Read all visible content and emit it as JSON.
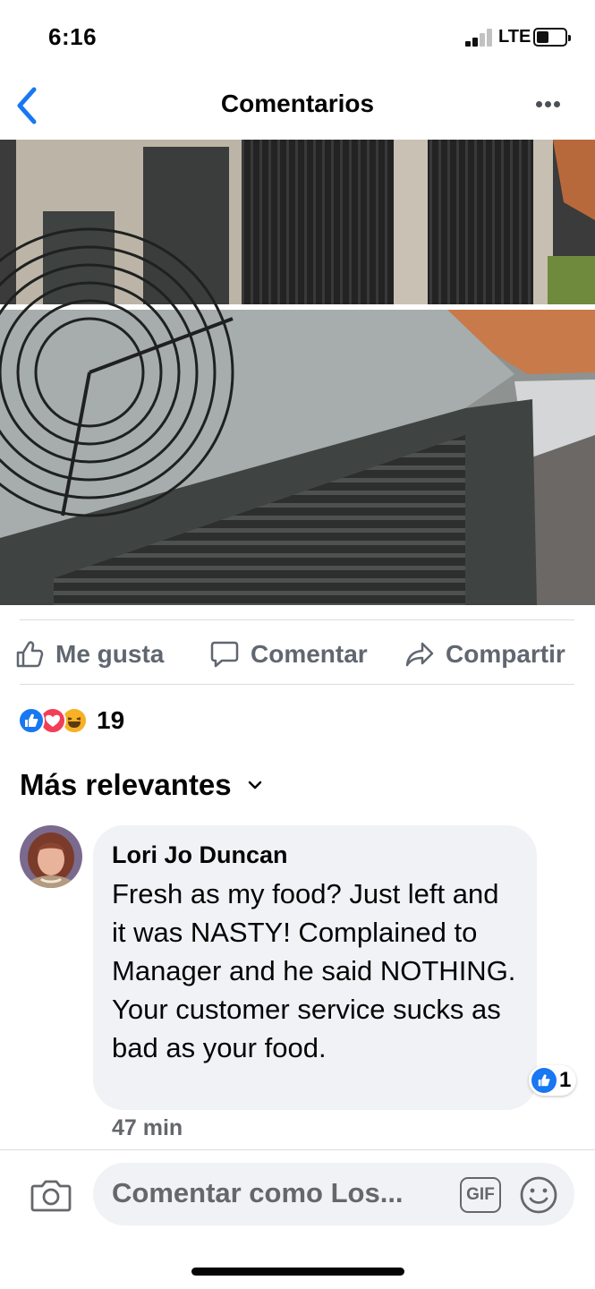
{
  "status_bar": {
    "time": "6:16",
    "network": "LTE"
  },
  "header": {
    "title": "Comentarios"
  },
  "post_actions": {
    "like": "Me gusta",
    "comment": "Comentar",
    "share": "Compartir"
  },
  "reactions": {
    "count": "19"
  },
  "sort": {
    "label": "Más relevantes"
  },
  "comment": {
    "author": "Lori Jo Duncan",
    "text": "Fresh as my food?  Just left and it was NASTY! Complained to Manager and he said NOTHING. Your customer service sucks as bad as your food.",
    "likes": "1",
    "time": "47 min"
  },
  "composer": {
    "placeholder": "Comentar como Los...",
    "gif_label": "GIF"
  },
  "colors": {
    "facebook_blue": "#1877f2",
    "love_red": "#f33e58",
    "haha_yellow": "#f7b125",
    "muted_text": "#606770"
  }
}
